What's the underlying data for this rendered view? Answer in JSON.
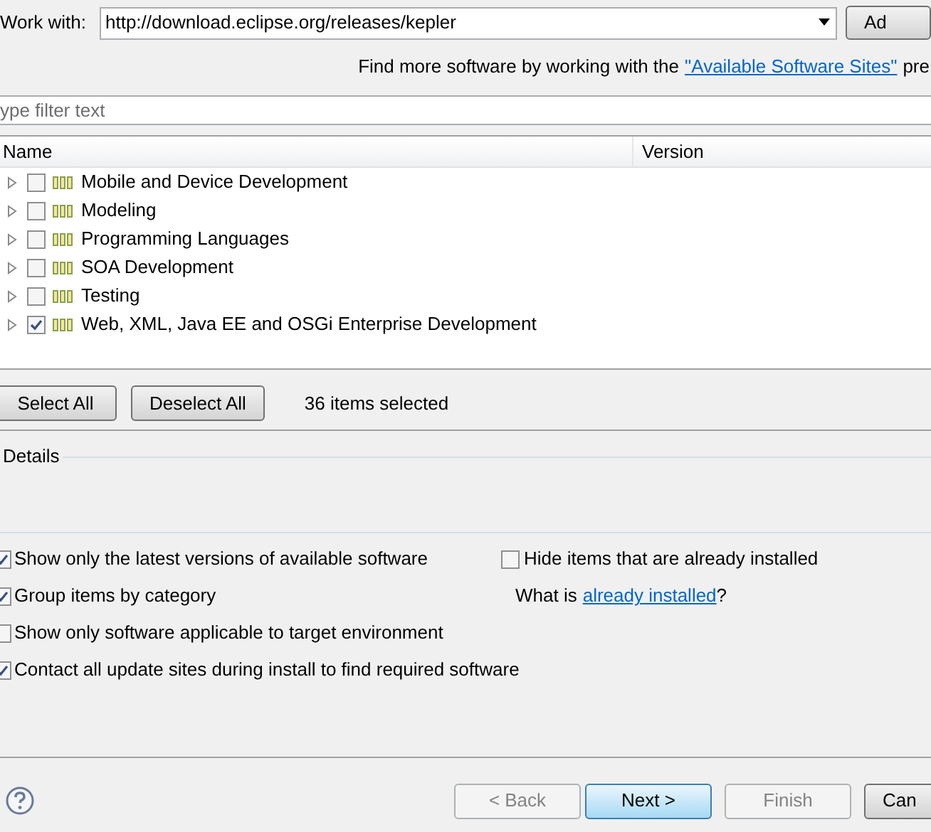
{
  "work_with": {
    "label": "Work with:",
    "value": "http://download.eclipse.org/releases/kepler",
    "button": "Ad"
  },
  "info": {
    "text": "Find more software by working with the",
    "link": "\"Available Software Sites\"",
    "suffix": "pre"
  },
  "filter": {
    "placeholder": "ype filter text"
  },
  "table": {
    "columns": [
      "Name",
      "Version"
    ],
    "rows": [
      {
        "label": "Mobile and Device Development",
        "checked": false
      },
      {
        "label": "Modeling",
        "checked": false
      },
      {
        "label": "Programming Languages",
        "checked": false
      },
      {
        "label": "SOA Development",
        "checked": false
      },
      {
        "label": "Testing",
        "checked": false
      },
      {
        "label": "Web, XML, Java EE and OSGi Enterprise Development",
        "checked": true
      }
    ]
  },
  "selection": {
    "buttons": [
      "Select All",
      "Deselect All"
    ],
    "count": "36 items selected"
  },
  "details": {
    "title": "Details"
  },
  "options_left": [
    {
      "label": "Show only the latest versions of available software",
      "checked": true
    },
    {
      "label": "Group items by category",
      "checked": true
    },
    {
      "label": "Show only software applicable to target environment",
      "checked": false
    },
    {
      "label": "Contact all update sites during install to find required software",
      "checked": true
    }
  ],
  "options_right": {
    "option": {
      "label": "Hide items that are already installed",
      "checked": false
    },
    "question": "What is",
    "link": "already installed",
    "question_end": "?"
  },
  "footer": {
    "buttons": [
      {
        "label": "< Back",
        "disabled": true,
        "default": false
      },
      {
        "label": "Next >",
        "disabled": false,
        "default": true
      },
      {
        "label": "Finish",
        "disabled": true,
        "default": false
      },
      {
        "label": "Can",
        "disabled": false,
        "default": false
      }
    ]
  }
}
